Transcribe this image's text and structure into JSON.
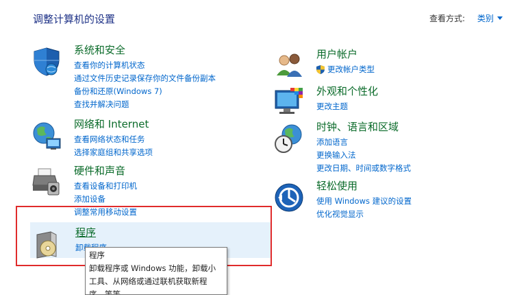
{
  "header": {
    "title": "调整计算机的设置",
    "view_by_label": "查看方式:",
    "view_by_value": "类别"
  },
  "categories": {
    "system_security": {
      "title": "系统和安全",
      "links": [
        "查看你的计算机状态",
        "通过文件历史记录保存你的文件备份副本",
        "备份和还原(Windows 7)",
        "查找并解决问题"
      ]
    },
    "network": {
      "title": "网络和 Internet",
      "links": [
        "查看网络状态和任务",
        "选择家庭组和共享选项"
      ]
    },
    "hardware": {
      "title": "硬件和声音",
      "links": [
        "查看设备和打印机",
        "添加设备",
        "调整常用移动设置"
      ]
    },
    "programs": {
      "title": "程序",
      "links": [
        "卸载程序"
      ]
    },
    "user_accounts": {
      "title": "用户帐户",
      "links": [
        "更改帐户类型"
      ]
    },
    "appearance": {
      "title": "外观和个性化",
      "links": [
        "更改主题"
      ]
    },
    "clock_region": {
      "title": "时钟、语言和区域",
      "links": [
        "添加语言",
        "更换输入法",
        "更改日期、时间或数字格式"
      ]
    },
    "ease_access": {
      "title": "轻松使用",
      "links": [
        "使用 Windows 建议的设置",
        "优化视觉显示"
      ]
    }
  },
  "tooltip": {
    "lines": [
      "程序",
      "卸载程序或 Windows 功能，卸载小",
      "工具、从网络或通过联机获取新程",
      "序，等等"
    ]
  },
  "colors": {
    "title_blue": "#1e3287",
    "link_blue": "#0066cc",
    "category_green": "#0b6b2a",
    "highlight_red": "#e02b2b",
    "hover_bg": "#e5f1fb"
  },
  "icons": {
    "system_security": "shield-icon",
    "network": "globe-network-icon",
    "hardware": "printer-icon",
    "programs": "programs-disc-icon",
    "user_accounts": "users-icon",
    "appearance": "monitor-palette-icon",
    "clock_region": "clock-globe-icon",
    "ease_access": "ease-of-access-icon"
  }
}
